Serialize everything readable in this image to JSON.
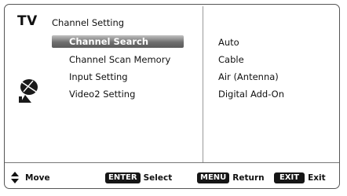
{
  "header": {
    "brand": "TV",
    "menu_title": "Channel Setting"
  },
  "menu": {
    "items": [
      {
        "label": "Channel Search",
        "selected": true
      },
      {
        "label": "Channel Scan Memory",
        "selected": false
      },
      {
        "label": "Input Setting",
        "selected": false
      },
      {
        "label": "Video2 Setting",
        "selected": false
      }
    ]
  },
  "options": {
    "items": [
      "Auto",
      "Cable",
      "Air (Antenna)",
      "Digital Add-On"
    ]
  },
  "footer": {
    "move": {
      "icon": "up-down-arrows-icon",
      "label": "Move"
    },
    "select": {
      "key": "ENTER",
      "label": "Select"
    },
    "return": {
      "key": "MENU",
      "label": "Return"
    },
    "exit": {
      "key": "EXIT",
      "label": "Exit"
    }
  },
  "colors": {
    "highlight": "#6f6f6f",
    "key_bg": "#161616",
    "border": "#555555"
  }
}
